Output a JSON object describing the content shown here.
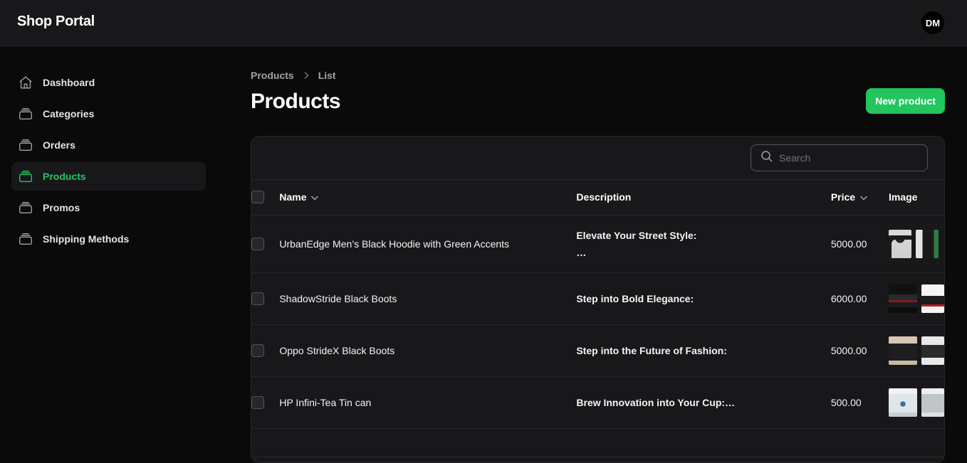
{
  "app": {
    "title": "Shop Portal",
    "user_initials": "DM"
  },
  "sidebar": {
    "items": [
      {
        "label": "Dashboard",
        "icon": "home-icon",
        "active": false
      },
      {
        "label": "Categories",
        "icon": "stack-icon",
        "active": false
      },
      {
        "label": "Orders",
        "icon": "stack-icon",
        "active": false
      },
      {
        "label": "Products",
        "icon": "stack-icon",
        "active": true
      },
      {
        "label": "Promos",
        "icon": "stack-icon",
        "active": false
      },
      {
        "label": "Shipping Methods",
        "icon": "stack-icon",
        "active": false
      }
    ]
  },
  "breadcrumb": {
    "items": [
      "Products",
      "List"
    ]
  },
  "page": {
    "title": "Products",
    "new_button": "New product"
  },
  "search": {
    "placeholder": "Search"
  },
  "table": {
    "headers": {
      "name": "Name",
      "description": "Description",
      "price": "Price",
      "image": "Image"
    },
    "rows": [
      {
        "name": "UrbanEdge Men’s Black Hoodie with Green Accents",
        "description": "Elevate Your Street Style:",
        "description_more": "…",
        "price": "5000.00",
        "thumbs": [
          "hoodie-photo",
          "hoodie-photo-2"
        ]
      },
      {
        "name": "ShadowStride Black Boots",
        "description": "Step into Bold Elegance:",
        "description_more": "",
        "price": "6000.00",
        "thumbs": [
          "red-black-boots-photo",
          "boots-photo-2"
        ]
      },
      {
        "name": "Oppo StrideX Black Boots",
        "description": "Step into the Future of Fashion:",
        "description_more": "",
        "price": "5000.00",
        "thumbs": [
          "black-boots-photo",
          "boots-photo-3"
        ]
      },
      {
        "name": "HP Infini-Tea Tin can",
        "description": "Brew Innovation into Your Cup:…",
        "description_more": "",
        "price": "500.00",
        "thumbs": [
          "tea-tin-photo",
          "tea-tin-photo-2"
        ]
      }
    ]
  },
  "colors": {
    "accent": "#22c55e",
    "background": "#0a0a0b",
    "panel": "#18181b",
    "border": "#27272a"
  }
}
